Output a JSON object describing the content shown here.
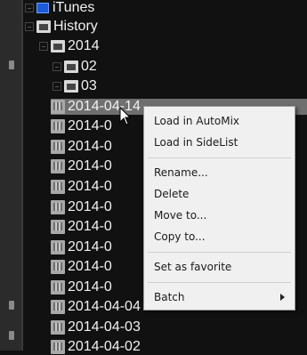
{
  "tree": {
    "items": [
      {
        "label": "iTunes"
      },
      {
        "label": "History"
      },
      {
        "label": "2014"
      },
      {
        "label": "02"
      },
      {
        "label": "03"
      },
      {
        "label": "2014-04-14"
      },
      {
        "label": "2014-0"
      },
      {
        "label": "2014-0"
      },
      {
        "label": "2014-0"
      },
      {
        "label": "2014-0"
      },
      {
        "label": "2014-0"
      },
      {
        "label": "2014-0"
      },
      {
        "label": "2014-0"
      },
      {
        "label": "2014-0"
      },
      {
        "label": "2014-0"
      },
      {
        "label": "2014-04-04"
      },
      {
        "label": "2014-04-03"
      },
      {
        "label": "2014-04-02"
      }
    ]
  },
  "context_menu": {
    "load_automix": "Load in AutoMix",
    "load_sidelist": "Load in SideList",
    "rename": "Rename...",
    "delete": "Delete",
    "move_to": "Move to...",
    "copy_to": "Copy to...",
    "set_favorite": "Set as favorite",
    "batch": "Batch"
  },
  "colors": {
    "background": "#111111",
    "selection": "#6f6f6f",
    "menu_background": "#f0f0f0"
  }
}
